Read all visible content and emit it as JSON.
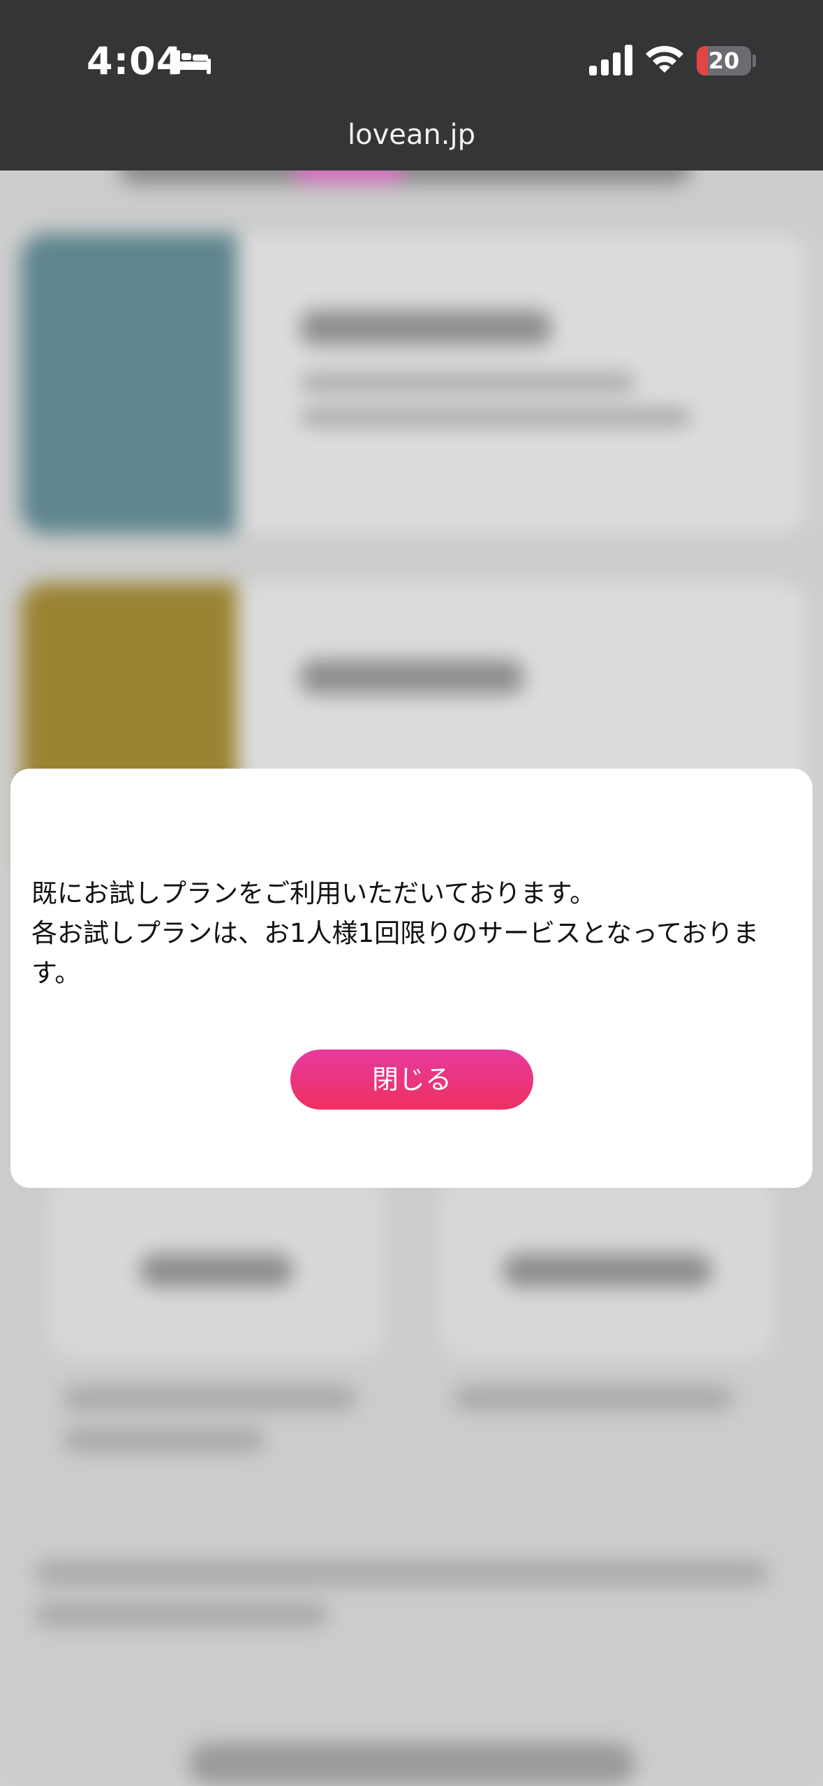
{
  "status_bar": {
    "time": "4:04",
    "battery_level": "20",
    "battery_fraction": 0.2,
    "icons": [
      "bed-icon",
      "cellular-signal-icon",
      "wifi-icon",
      "battery-icon"
    ]
  },
  "browser": {
    "url": "lovean.jp"
  },
  "modal": {
    "message": "既にお試しプランをご利用いただいております。\n各お試しプランは、お1人様1回限りのサービスとなっております。",
    "close_label": "閉じる"
  },
  "colors": {
    "status_bar_bg": "#343537",
    "battery_low": "#e34545",
    "button_gradient_top": "#e63a9e",
    "button_gradient_bottom": "#ef3060",
    "card_teal": "#5f858f",
    "card_gold": "#9a8332"
  }
}
